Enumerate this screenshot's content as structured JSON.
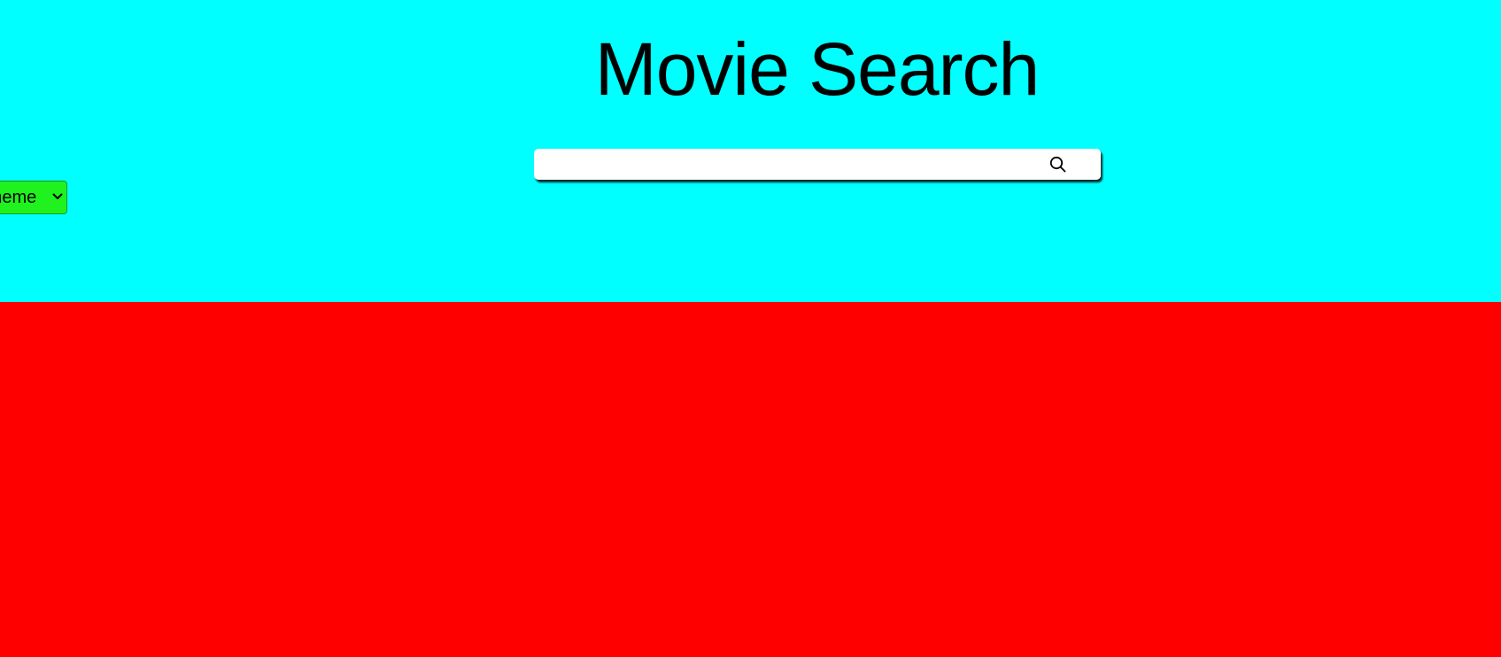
{
  "app": {
    "title": "Movie Search"
  },
  "search": {
    "placeholder": "",
    "value": "",
    "button_icon": "search-icon"
  },
  "theme_select": {
    "selected_label": "Theme",
    "icon": "chevron-down-icon"
  },
  "colors": {
    "header_background": "#00ffff",
    "content_background": "#ff0000",
    "theme_select_background": "#1ff21f",
    "title_text": "#000000",
    "search_background": "#ffffff"
  }
}
